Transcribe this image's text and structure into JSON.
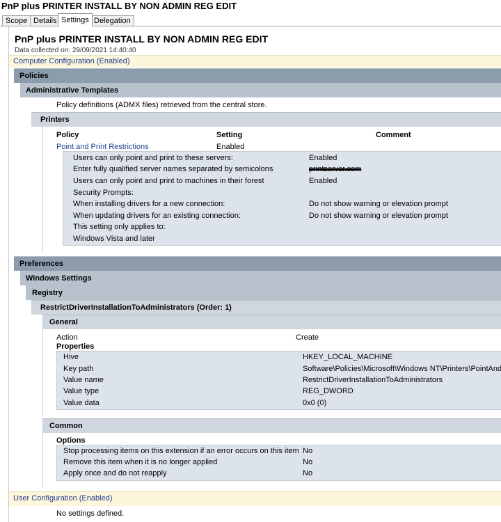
{
  "window_title": "PnP plus PRINTER INSTALL BY NON ADMIN REG EDIT",
  "tabs": [
    {
      "label": "Scope"
    },
    {
      "label": "Details"
    },
    {
      "label": "Settings"
    },
    {
      "label": "Delegation"
    }
  ],
  "report": {
    "title": "PnP plus PRINTER INSTALL BY NON ADMIN REG EDIT",
    "collected": "Data collected on: 29/09/2021 14:40:40",
    "computer_config": "Computer Configuration (Enabled)",
    "policies": {
      "header": "Policies",
      "admin_templates": {
        "header": "Administrative Templates",
        "note": "Policy definitions (ADMX files) retrieved from the central store."
      },
      "printers": {
        "header": "Printers",
        "columns": {
          "policy": "Policy",
          "setting": "Setting",
          "comment": "Comment"
        },
        "policy_name": "Point and Print Restrictions",
        "policy_setting": "Enabled",
        "details": [
          {
            "label": "Users can only point and print to these servers:",
            "value": "Enabled"
          },
          {
            "label": "Enter fully qualified server names separated by semicolons",
            "value": "printserver.com"
          },
          {
            "label": "Users can only point and print to machines in their forest",
            "value": "Enabled"
          },
          {
            "label": "Security Prompts:",
            "value": ""
          },
          {
            "label": "When installing drivers for a new connection:",
            "value": "Do not show warning or elevation prompt"
          },
          {
            "label": "When updating drivers for an existing connection:",
            "value": "Do not show warning or elevation prompt"
          },
          {
            "label": "This setting only applies to:",
            "value": ""
          },
          {
            "label": "Windows Vista and later",
            "value": ""
          }
        ]
      }
    },
    "preferences": {
      "header": "Preferences",
      "windows_settings": "Windows Settings",
      "registry": "Registry",
      "item": "RestrictDriverInstallationToAdministrators (Order: 1)",
      "general": {
        "header": "General",
        "action_label": "Action",
        "action_value": "Create",
        "properties_label": "Properties",
        "properties": [
          {
            "label": "Hive",
            "value": "HKEY_LOCAL_MACHINE"
          },
          {
            "label": "Key path",
            "value": "Software\\Policies\\Microsoft\\Windows NT\\Printers\\PointAndPrint"
          },
          {
            "label": "Value name",
            "value": "RestrictDriverInstallationToAdministrators"
          },
          {
            "label": "Value type",
            "value": "REG_DWORD"
          },
          {
            "label": "Value data",
            "value": "0x0 (0)"
          }
        ]
      },
      "common": {
        "header": "Common",
        "options_label": "Options",
        "options": [
          {
            "label": "Stop processing items on this extension if an error occurs on this item",
            "value": "No"
          },
          {
            "label": "Remove this item when it is no longer applied",
            "value": "No"
          },
          {
            "label": "Apply once and do not reapply",
            "value": "No"
          }
        ]
      }
    },
    "user_config": "User Configuration (Enabled)",
    "user_config_note": "No settings defined."
  }
}
